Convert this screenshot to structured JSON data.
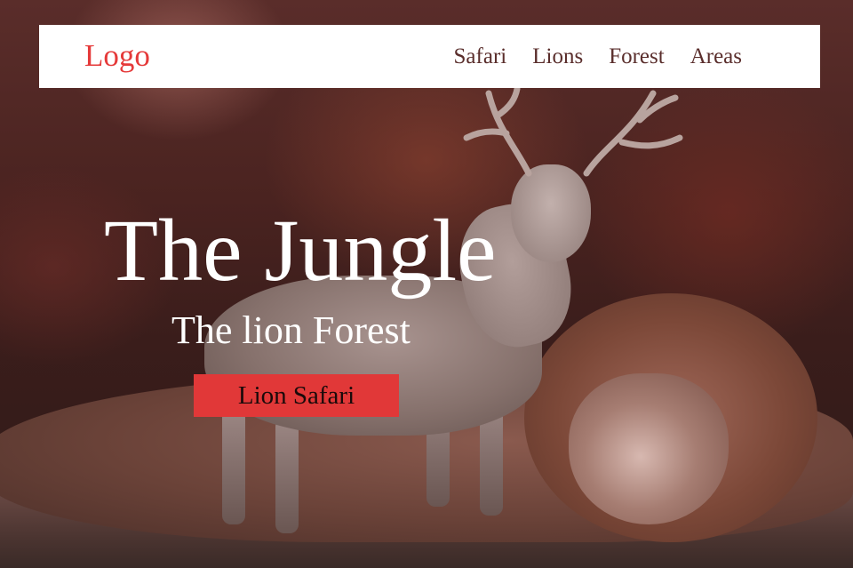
{
  "brand": {
    "logo_text": "Logo",
    "accent_color": "#e53a3a"
  },
  "nav": {
    "items": [
      {
        "label": "Safari"
      },
      {
        "label": "Lions"
      },
      {
        "label": "Forest"
      },
      {
        "label": "Areas"
      }
    ]
  },
  "hero": {
    "title": "The Jungle",
    "subtitle": "The lion Forest",
    "cta_label": "Lion Safari",
    "cta_color": "#e13838"
  }
}
